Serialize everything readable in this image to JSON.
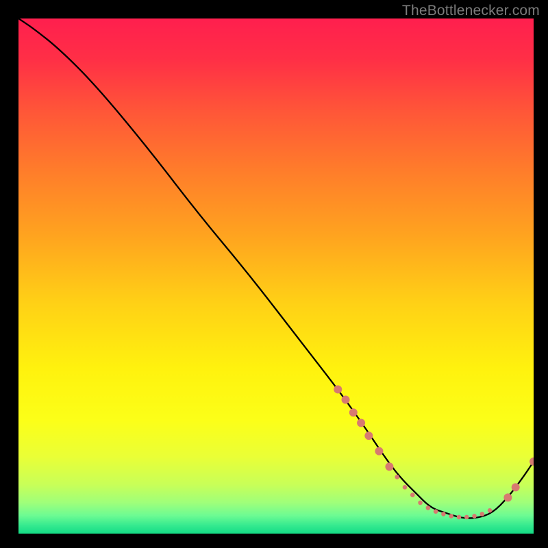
{
  "watermark": "TheBottlenecker.com",
  "chart_data": {
    "type": "line",
    "title": "",
    "xlabel": "",
    "ylabel": "",
    "xlim": [
      0,
      100
    ],
    "ylim": [
      0,
      100
    ],
    "background": {
      "type": "vertical-gradient",
      "stops": [
        {
          "pos": 0.0,
          "color": "#ff1f4e"
        },
        {
          "pos": 0.08,
          "color": "#ff2f46"
        },
        {
          "pos": 0.18,
          "color": "#ff5638"
        },
        {
          "pos": 0.3,
          "color": "#ff7e2a"
        },
        {
          "pos": 0.42,
          "color": "#ffa31f"
        },
        {
          "pos": 0.55,
          "color": "#ffd016"
        },
        {
          "pos": 0.68,
          "color": "#fff20e"
        },
        {
          "pos": 0.78,
          "color": "#fcff18"
        },
        {
          "pos": 0.85,
          "color": "#eaff36"
        },
        {
          "pos": 0.905,
          "color": "#c8ff58"
        },
        {
          "pos": 0.94,
          "color": "#9fff7a"
        },
        {
          "pos": 0.965,
          "color": "#6cfb93"
        },
        {
          "pos": 0.985,
          "color": "#33e98f"
        },
        {
          "pos": 1.0,
          "color": "#14db85"
        }
      ]
    },
    "series": [
      {
        "name": "bottleneck-curve",
        "color": "#000000",
        "x": [
          0,
          3,
          8,
          15,
          25,
          35,
          45,
          55,
          62,
          67,
          71,
          74,
          77,
          80,
          83,
          86,
          89,
          92,
          95,
          98,
          100
        ],
        "values": [
          100,
          98,
          94,
          87,
          75,
          62,
          50,
          37,
          28,
          21,
          15,
          11,
          8,
          5,
          4,
          3,
          3,
          4,
          7,
          11,
          14
        ]
      }
    ],
    "markers": {
      "name": "highlight-points",
      "color": "#d77a70",
      "radius_large": 6,
      "radius_small": 3.3,
      "points": [
        {
          "x": 62.0,
          "y": 28.0,
          "r": "large"
        },
        {
          "x": 63.5,
          "y": 26.0,
          "r": "large"
        },
        {
          "x": 65.0,
          "y": 23.5,
          "r": "large"
        },
        {
          "x": 66.5,
          "y": 21.5,
          "r": "large"
        },
        {
          "x": 68.0,
          "y": 19.0,
          "r": "large"
        },
        {
          "x": 70.0,
          "y": 16.0,
          "r": "large"
        },
        {
          "x": 72.0,
          "y": 13.0,
          "r": "large"
        },
        {
          "x": 73.5,
          "y": 11.0,
          "r": "small"
        },
        {
          "x": 75.0,
          "y": 9.0,
          "r": "small"
        },
        {
          "x": 76.5,
          "y": 7.5,
          "r": "small"
        },
        {
          "x": 78.0,
          "y": 6.0,
          "r": "small"
        },
        {
          "x": 79.5,
          "y": 5.0,
          "r": "small"
        },
        {
          "x": 81.0,
          "y": 4.3,
          "r": "small"
        },
        {
          "x": 82.5,
          "y": 3.8,
          "r": "small"
        },
        {
          "x": 84.0,
          "y": 3.4,
          "r": "small"
        },
        {
          "x": 85.5,
          "y": 3.2,
          "r": "small"
        },
        {
          "x": 87.0,
          "y": 3.2,
          "r": "small"
        },
        {
          "x": 88.5,
          "y": 3.4,
          "r": "small"
        },
        {
          "x": 90.0,
          "y": 3.8,
          "r": "small"
        },
        {
          "x": 91.5,
          "y": 4.5,
          "r": "small"
        },
        {
          "x": 95.0,
          "y": 7.0,
          "r": "large"
        },
        {
          "x": 96.5,
          "y": 9.0,
          "r": "large"
        },
        {
          "x": 100.0,
          "y": 14.0,
          "r": "large"
        }
      ]
    }
  }
}
